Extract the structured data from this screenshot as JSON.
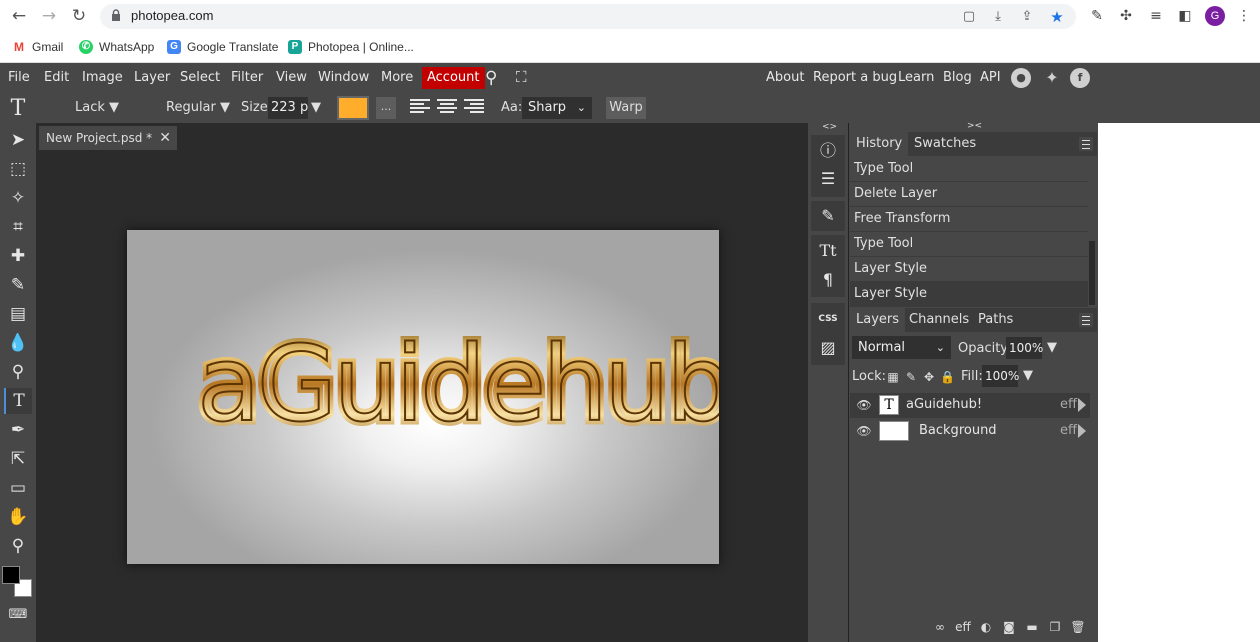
{
  "browser": {
    "url": "photopea.com",
    "bookmarks": [
      {
        "label": "Gmail",
        "icon": "gmail-icon",
        "color": "#ea4335"
      },
      {
        "label": "WhatsApp",
        "icon": "whatsapp-icon",
        "color": "#25d366"
      },
      {
        "label": "Google Translate",
        "icon": "translate-icon",
        "color": "#4285f4"
      },
      {
        "label": "Photopea | Online...",
        "icon": "photopea-icon",
        "color": "#18a497"
      }
    ],
    "profile_initial": "G"
  },
  "menubar": {
    "items": [
      "File",
      "Edit",
      "Image",
      "Layer",
      "Select",
      "Filter",
      "View",
      "Window",
      "More"
    ],
    "account_label": "Account",
    "right_links": [
      "About",
      "Report a bug",
      "Learn",
      "Blog",
      "API"
    ],
    "account_color": "#c20000"
  },
  "options": {
    "font_family": "Lack ▼",
    "font_style": "Regular ▼",
    "size_label": "Size:",
    "size_value": "223 p",
    "size_arrow": "▼",
    "text_color": "#ffad2a",
    "more_label": "...",
    "aa_label": "Aa:",
    "aa_value": "Sharp",
    "warp_label": "Warp"
  },
  "document": {
    "tab_title": "New Project.psd *",
    "close_glyph": "✕"
  },
  "history": {
    "tabs": [
      "History",
      "Swatches"
    ],
    "items": [
      "Type Tool",
      "Delete Layer",
      "Free Transform",
      "Type Tool",
      "Layer Style",
      "Layer Style"
    ],
    "active_index": 5
  },
  "layers": {
    "tabs": [
      "Layers",
      "Channels",
      "Paths"
    ],
    "blend_mode": "Normal",
    "opacity_label": "Opacity:",
    "opacity_value": "100%",
    "lock_label": "Lock:",
    "fill_label": "Fill:",
    "fill_value": "100%",
    "rows": [
      {
        "name": "aGuidehub!",
        "eff": "eff",
        "thumb": "T"
      },
      {
        "name": "Background",
        "eff": "eff",
        "thumb": ""
      }
    ],
    "footer_eff": "eff"
  }
}
